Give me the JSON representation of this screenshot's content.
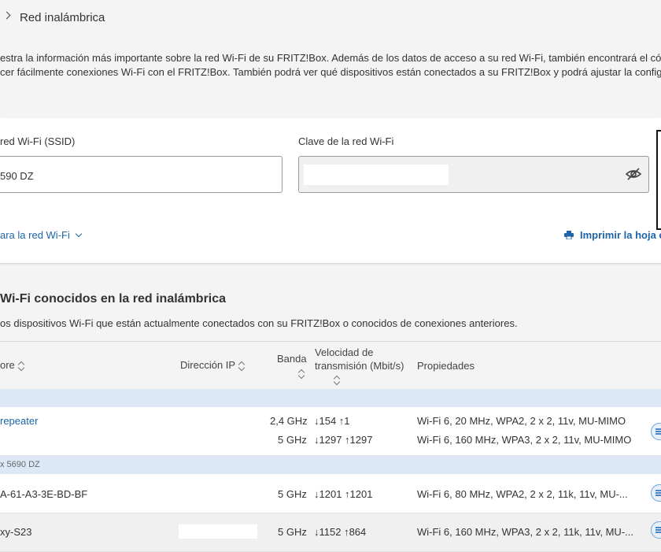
{
  "breadcrumb": {
    "current": "Red inalámbrica"
  },
  "intro": {
    "line1": "estra la información más importante sobre la red Wi-Fi de su FRITZ!Box. Además de los datos de acceso a su red Wi-Fi, también encontrará el códi",
    "line2": "cer fácilmente conexiones Wi-Fi con el FRITZ!Box. También podrá ver qué dispositivos están conectados a su FRITZ!Box y podrá ajustar la configu"
  },
  "wifi_card": {
    "ssid_label": "red Wi-Fi (SSID)",
    "ssid_value": "590 DZ",
    "key_label": "Clave de la red Wi-Fi",
    "connect_link": "ara la red Wi-Fi",
    "print_link": "Imprimir la hoja c"
  },
  "devices": {
    "title": "Wi-Fi conocidos en la red inalámbrica",
    "description": "os dispositivos Wi-Fi que están actualmente conectados con su FRITZ!Box o conocidos de conexiones anteriores.",
    "columns": {
      "name": "ore",
      "ip": "Dirección IP",
      "band": "Banda",
      "speed_line1": "Velocidad de",
      "speed_line2": "transmisión (Mbit/s)",
      "properties": "Propiedades"
    },
    "group2_label": "x 5690 DZ",
    "rows": [
      {
        "name": "repeater",
        "band1": "2,4 GHz",
        "speed1": "↓154  ↑1",
        "props1": "Wi-Fi 6, 20 MHz, WPA2, 2 x 2, 11v, MU-MIMO",
        "band2": "5 GHz",
        "speed2": "↓1297 ↑1297",
        "props2": "Wi-Fi 6, 160 MHz, WPA3, 2 x 2, 11v, MU-MIMO"
      },
      {
        "name": "A-61-A3-3E-BD-BF",
        "band": "5 GHz",
        "speed": "↓1201 ↑1201",
        "props": "Wi-Fi 6, 80 MHz, WPA2, 2 x 2, 11k, 11v, MU-..."
      },
      {
        "name": "xy-S23",
        "band": "5 GHz",
        "speed": "↓1152 ↑864",
        "props": "Wi-Fi 6, 160 MHz, WPA3, 2 x 2, 11k, 11v, MU-..."
      }
    ]
  },
  "colors": {
    "link": "#1d64a8",
    "group_band": "#dce8f5",
    "card": "#ffffff",
    "page": "#f4f4f4"
  },
  "icons": [
    "chevron-right-icon",
    "eye-slash-icon",
    "chevron-down-icon",
    "printer-icon",
    "sort-icon",
    "details-icon"
  ]
}
